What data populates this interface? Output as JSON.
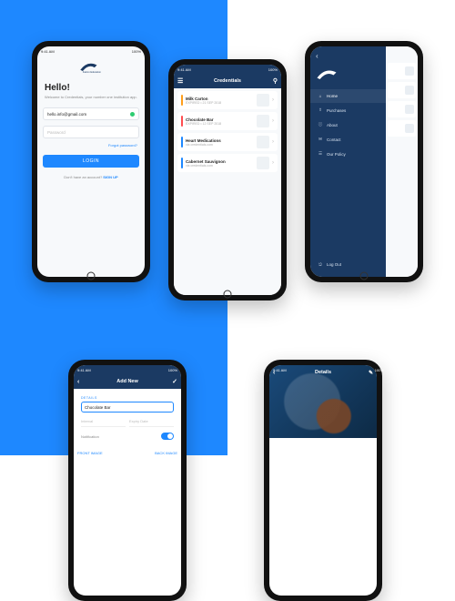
{
  "status": {
    "time": "9:41 AM",
    "battery": "100%"
  },
  "brand": "Falcon Education",
  "colors": {
    "primary": "#1e88ff",
    "navy": "#1b3a63"
  },
  "login": {
    "greeting": "Hello!",
    "subtitle": "Welcome to Credentials, your number one institution app.",
    "email_value": "hello.info@gmail.com",
    "password_placeholder": "Password",
    "forgot": "Forgot password?",
    "login_btn": "LOGIN",
    "signup_prompt": "Don't have an account? ",
    "signup_link": "SIGN UP"
  },
  "creds": {
    "title": "Credentials",
    "items": [
      {
        "name": "Milk Carton",
        "meta": "EXPIRED • 21 SEP 2018",
        "color": "#ff9f1c"
      },
      {
        "name": "Chocolate Bar",
        "meta": "EXPIRED • 12 SEP 2018",
        "color": "#ff4d4f"
      },
      {
        "name": "Heart Medications",
        "meta": "via credentials.com",
        "color": "#1e88ff"
      },
      {
        "name": "Cabernet Sauvignon",
        "meta": "via credentials.com",
        "color": "#1e88ff"
      }
    ]
  },
  "drawer": {
    "items": [
      {
        "icon": "⌂",
        "label": "Home",
        "active": true
      },
      {
        "icon": "⇪",
        "label": "Purchases"
      },
      {
        "icon": "ⓘ",
        "label": "About"
      },
      {
        "icon": "✉",
        "label": "Contact"
      },
      {
        "icon": "☰",
        "label": "Our Policy"
      }
    ],
    "logout": {
      "icon": "⎋",
      "label": "Log Out"
    }
  },
  "addnew": {
    "title": "Add New",
    "section": "DETAILS",
    "name_value": "Chocolate Bar",
    "interval_placeholder": "Interval",
    "expiry_placeholder": "Expiry Date",
    "notification_label": "Notification",
    "front_label": "FRONT IMAGE",
    "back_label": "BACK IMAGE"
  },
  "details": {
    "title": "Details"
  }
}
